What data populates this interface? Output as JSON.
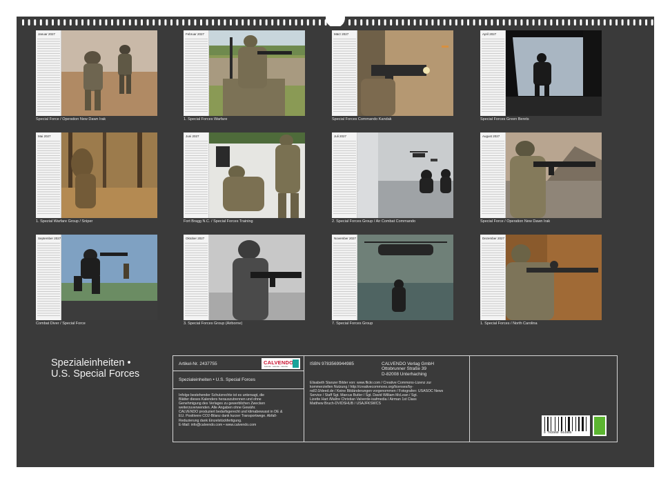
{
  "colors": {
    "board": "#3a3a3a",
    "text": "#e8e8e8",
    "accent_red": "#c8102e",
    "accent_teal": "#1aa39a"
  },
  "months": [
    {
      "name": "Januar 2027",
      "caption": "Special Force / Operation New Dawn Irak"
    },
    {
      "name": "Februar 2027",
      "caption": "1. Special Forces Warfare"
    },
    {
      "name": "März 2027",
      "caption": "Special Forces Commando Kandak"
    },
    {
      "name": "April 2027",
      "caption": "Special Forces Green Berets"
    },
    {
      "name": "Mai 2027",
      "caption": "1. Spezial Warfare Group / Sniper"
    },
    {
      "name": "Juni 2027",
      "caption": "Fort Bragg N.C. / Special Forces Training"
    },
    {
      "name": "Juli 2027",
      "caption": "2. Special Forces Group / Air Combat Commando"
    },
    {
      "name": "August 2027",
      "caption": "Special Force / Operation New Dawn Irak"
    },
    {
      "name": "September 2027",
      "caption": "Combat Diver / Special Force"
    },
    {
      "name": "Oktober 2027",
      "caption": "3. Special Forces Group (Airborne)"
    },
    {
      "name": "November 2027",
      "caption": "7. Special Forces Group"
    },
    {
      "name": "Dezember 2027",
      "caption": "1. Special Forces / North Carolina"
    }
  ],
  "title": {
    "line1": "Spezialeinheiten •",
    "line2": "U.S. Special Forces"
  },
  "info": {
    "article": "Artikel-Nr. 2437755",
    "logo_text": "CALVENDO",
    "logo_sub": "kalender · kalender · kalender",
    "product_title": "Spezialeinheiten • U.S. Special Forces",
    "legal": [
      "Infolge bestehender Schutzrechte ist es untersagt, die",
      "Blätter dieses Kalenders herauszutrennen und ohne",
      "Genehmigung des Verlages zu gewerblichen Zwecken",
      "weiterzuverwenden. Alle Angaben ohne Gewähr.",
      "CALVENDO produziert bedarfsgerecht und klimabewusst in DE &",
      "EU. Positivere CO2-Bilanz dank kurzer Transportwege. Abfall-",
      "Reduzierung dank Einzelstückfertigung.",
      "E-Mail: info@calvendo.com • www.calvendo.com"
    ],
    "isbn": "ISBN 9783569944985",
    "publisher": [
      "CALVENDO Verlag GmbH",
      "Ottobrunner Straße 39",
      "D-82008 Unterhaching"
    ],
    "credits": [
      "Elisabeth Stanzer Bilder von: www.flickr.com / Creative Commons-Lizenz zur",
      "kommerziellen Nutzung / http://creativecommons.org/licenses/by-",
      "nd/2.0/deed.de / Keine Bildänderungen vorgenommen / Fotografen: USASOC News",
      "Service / Staff Sgt. Marcus Butler / Sgt. David William McLean / Sgt.",
      "Lizette Hart /Maître Christian Valverde-isafmedia / Airman 1st Class",
      "Matthew Bruch-DVIDSHUB / USAJFKSWCS"
    ],
    "barcode_number": "9 783569 944985"
  }
}
